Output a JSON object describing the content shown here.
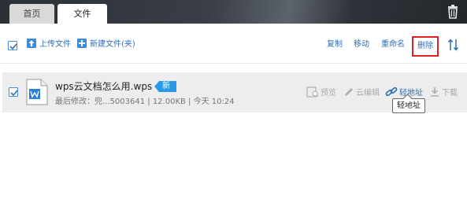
{
  "tabs": [
    {
      "label": "首页"
    },
    {
      "label": "文件"
    }
  ],
  "toolbar": {
    "upload_label": "上传文件",
    "new_folder_label": "新建文件(夹)",
    "copy_label": "复制",
    "move_label": "移动",
    "rename_label": "重命名",
    "delete_label": "删除"
  },
  "file": {
    "name": "wps云文档怎么用.wps",
    "badge": "新",
    "meta_prefix": "最后修改：",
    "modifier": "兜...5003641",
    "size": "12.00KB",
    "time": "今天 10:24",
    "sep": " | ",
    "actions": {
      "preview": "预览",
      "cloud_edit": "云编辑",
      "link": "轻地址",
      "download": "下载"
    }
  },
  "tooltip": "轻地址",
  "colors": {
    "accent": "#2e6fb8",
    "badge": "#2b9ae6",
    "delete_highlight": "#e02020",
    "row_bg": "#ededed"
  },
  "icons": [
    "trash-icon",
    "upload-icon",
    "plus-icon",
    "sort-icon",
    "wps-file-icon",
    "preview-icon",
    "pencil-icon",
    "link-icon",
    "download-icon"
  ]
}
